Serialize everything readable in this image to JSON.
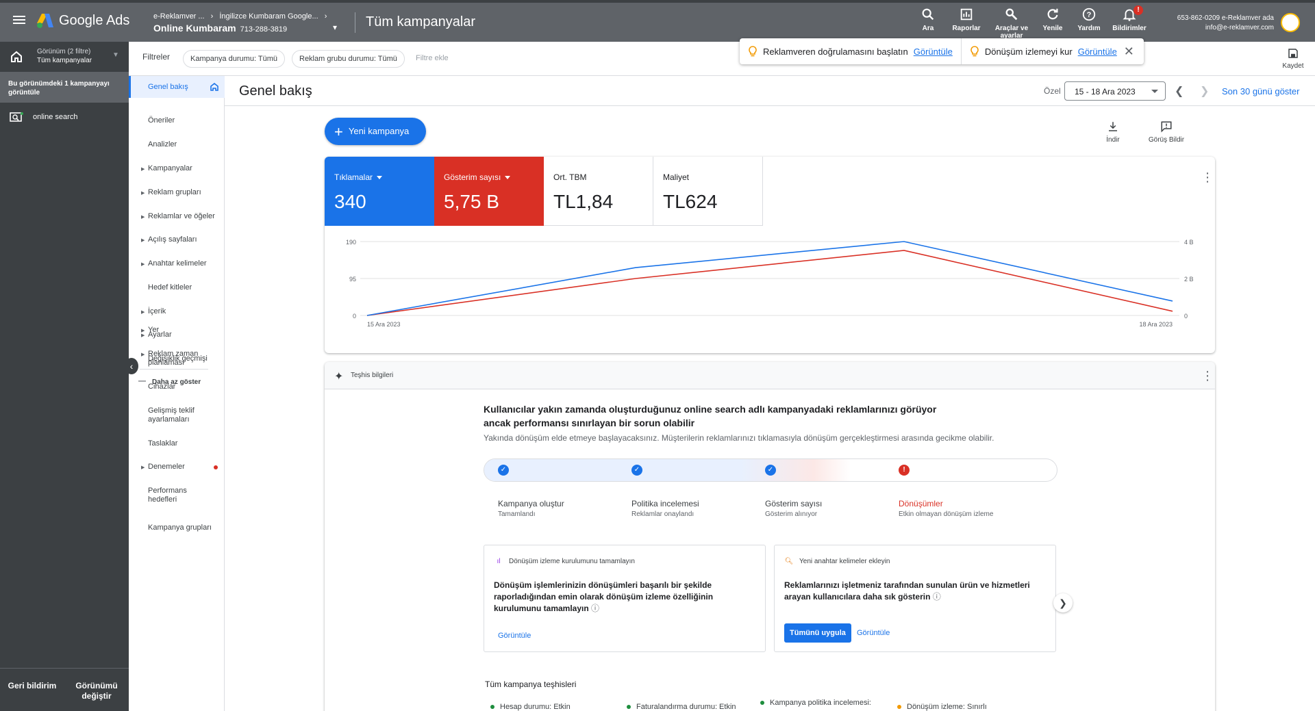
{
  "topbar": {
    "app_name": "Google Ads",
    "account_path": "e-Reklamver ...",
    "account_path2": "İngilizce Kumbaram Google...",
    "account_name": "Online Kumbaram",
    "account_id": "713-288-3819",
    "page_title": "Tüm kampanyalar",
    "actions": [
      {
        "label": "Ara",
        "icon": "search-icon"
      },
      {
        "label": "Raporlar",
        "icon": "reports-icon"
      },
      {
        "label": "Araçlar ve ayarlar",
        "icon": "wrench-icon"
      },
      {
        "label": "Yenile",
        "icon": "refresh-icon"
      },
      {
        "label": "Yardım",
        "icon": "help-icon"
      },
      {
        "label": "Bildirimler",
        "icon": "bell-icon"
      }
    ],
    "notif_badge": "!",
    "contact_line1": "653-862-0209 e-Reklamver ada",
    "contact_line2": "info@e-reklamver.com"
  },
  "filters": {
    "label": "Filtreler",
    "chips": [
      "Kampanya durumu: Tümü",
      "Reklam grubu durumu: Tümü"
    ],
    "add_placeholder": "Filtre ekle",
    "save_label": "Kaydet"
  },
  "banner": {
    "items": [
      {
        "text": "Reklamveren doğrulamasını başlatın",
        "link": "Görüntüle"
      },
      {
        "text": "Dönüşüm izlemeyi kur",
        "link": "Görüntüle"
      }
    ]
  },
  "leftnav": {
    "view_title": "Görünüm (2 filtre)",
    "view_sub": "Tüm kampanyalar",
    "campaign_count": "Bu görünümdeki 1 kampanyayı görüntüle",
    "campaign_item": "online search",
    "bottom_feedback": "Geri bildirim",
    "bottom_switch": "Görünümü değiştir"
  },
  "subnav": {
    "items": [
      {
        "label": "Genel bakış",
        "active": true
      },
      {
        "label": "Öneriler"
      },
      {
        "label": "Analizler"
      },
      {
        "label": "Kampanyalar",
        "expand": true
      },
      {
        "label": "Reklam grupları",
        "expand": true
      },
      {
        "label": "Reklamlar ve öğeler",
        "expand": true
      },
      {
        "label": "Açılış sayfaları",
        "expand": true
      },
      {
        "label": "Anahtar kelimeler",
        "expand": true
      },
      {
        "label": "Hedef kitleler"
      },
      {
        "label": "İçerik",
        "expand": true
      },
      {
        "label": "Ayarlar",
        "expand": true
      },
      {
        "label": "Değişiklik geçmişi"
      }
    ],
    "less_label": "Daha az göster",
    "items2": [
      {
        "label": "Yer",
        "expand": true
      },
      {
        "label": "Reklam zaman planlaması",
        "expand": true
      },
      {
        "label": "Cihazlar"
      },
      {
        "label": "Gelişmiş teklif ayarlamaları"
      },
      {
        "label": "Taslaklar"
      },
      {
        "label": "Denemeler",
        "expand": true,
        "dot": true
      },
      {
        "label": "Performans hedefleri"
      },
      {
        "label": "Kampanya grupları"
      }
    ]
  },
  "main": {
    "title": "Genel bakış",
    "date_label": "Özel",
    "date_range": "15 - 18 Ara 2023",
    "last30": "Son 30 günü göster",
    "new_campaign": "Yeni kampanya",
    "download": "İndir",
    "feedback": "Görüş Bildir"
  },
  "metrics": [
    {
      "label": "Tıklamalar",
      "value": "340",
      "color": "#1a73e8"
    },
    {
      "label": "Gösterim sayısı",
      "value": "5,75 B",
      "color": "#d93025"
    },
    {
      "label": "Ort. TBM",
      "value": "TL1,84"
    },
    {
      "label": "Maliyet",
      "value": "TL624"
    }
  ],
  "chart_data": {
    "type": "line",
    "x": [
      "15 Ara 2023",
      "16 Ara 2023",
      "17 Ara 2023",
      "18 Ara 2023"
    ],
    "x_tick_labels": [
      "15 Ara 2023",
      "18 Ara 2023"
    ],
    "y_left_ticks": [
      "0",
      "95",
      "190"
    ],
    "y_right_ticks": [
      "0",
      "2 B",
      "4 B"
    ],
    "ylim_left": [
      0,
      190
    ],
    "ylim_right": [
      0,
      4000
    ],
    "grid": true,
    "series": [
      {
        "name": "Tıklamalar",
        "color": "#1a73e8",
        "axis": "left",
        "values": [
          0,
          123,
          190,
          37
        ]
      },
      {
        "name": "Gösterim sayısı",
        "color": "#d93025",
        "axis": "right",
        "values": [
          0,
          2000,
          3520,
          230
        ]
      }
    ]
  },
  "diagnostics": {
    "header": "Teşhis bilgileri",
    "title": "Kullanıcılar yakın zamanda oluşturduğunuz online search adlı kampanyadaki reklamlarınızı görüyor ancak performansı sınırlayan bir sorun olabilir",
    "subtitle": "Yakında dönüşüm elde etmeye başlayacaksınız. Müşterilerin reklamlarınızı tıklamasıyla dönüşüm gerçekleştirmesi arasında gecikme olabilir.",
    "steps": [
      {
        "label": "Kampanya oluştur",
        "sub": "Tamamlandı",
        "status": "ok"
      },
      {
        "label": "Politika incelemesi",
        "sub": "Reklamlar onaylandı",
        "status": "ok"
      },
      {
        "label": "Gösterim sayısı",
        "sub": "Gösterim alınıyor",
        "status": "ok"
      },
      {
        "label": "Dönüşümler",
        "sub": "Etkin olmayan dönüşüm izleme",
        "status": "error"
      }
    ],
    "rec1": {
      "head": "Dönüşüm izleme kurulumunu tamamlayın",
      "body": "Dönüşüm işlemlerinizin dönüşümleri başarılı bir şekilde raporladığından emin olarak dönüşüm izleme özelliğinin kurulumunu tamamlayın",
      "link": "Görüntüle"
    },
    "rec2": {
      "head": "Yeni anahtar kelimeler ekleyin",
      "body": "Reklamlarınızı işletmeniz tarafından sunulan ürün ve hizmetleri arayan kullanıcılara daha sık gösterin",
      "apply": "Tümünü uygula",
      "link": "Görüntüle"
    },
    "all_title": "Tüm kampanya teşhisleri",
    "statuses": [
      {
        "text": "Hesap durumu: Etkin",
        "color": "#1e8e3e"
      },
      {
        "text": "Faturalandırma durumu: Etkin",
        "color": "#1e8e3e"
      },
      {
        "text": "Kampanya politika incelemesi:",
        "color": "#1e8e3e"
      },
      {
        "text": "Dönüşüm izleme: Sınırlı",
        "color": "#f29900"
      }
    ]
  }
}
